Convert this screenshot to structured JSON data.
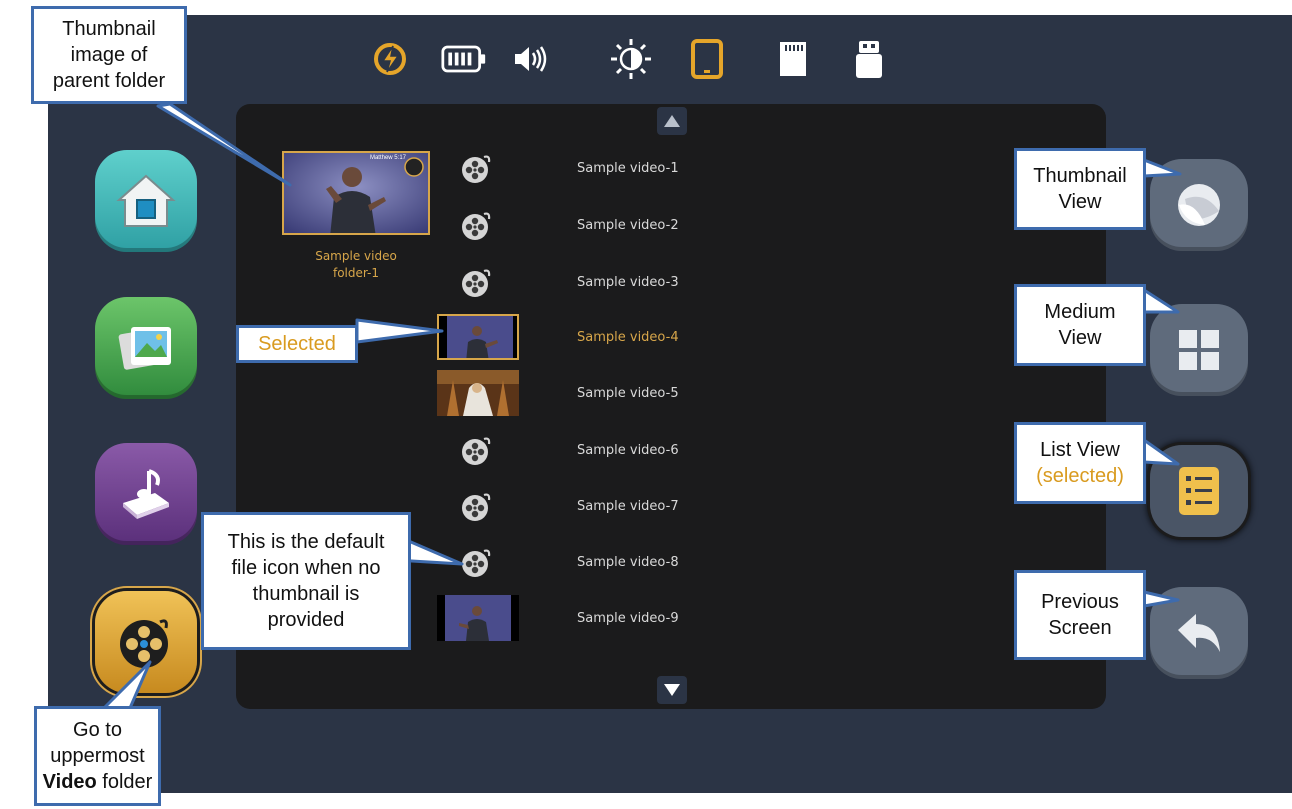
{
  "status_bar": {
    "icons": [
      "power-icon",
      "battery-icon",
      "volume-icon",
      "brightness-icon",
      "tablet-icon",
      "sd-card-icon",
      "usb-drive-icon"
    ]
  },
  "folder": {
    "name_line1": "Sample video",
    "name_line2": "folder-1",
    "thumb_caption": "Matthew 5:17"
  },
  "file_list": [
    {
      "label": "Sample video-1",
      "icon": "default-file-icon"
    },
    {
      "label": "Sample video-2",
      "icon": "default-file-icon"
    },
    {
      "label": "Sample video-3",
      "icon": "default-file-icon"
    },
    {
      "label": "Sample video-4",
      "icon": "thumbnail",
      "selected": true
    },
    {
      "label": "Sample video-5",
      "icon": "thumbnail"
    },
    {
      "label": "Sample video-6",
      "icon": "default-file-icon"
    },
    {
      "label": "Sample video-7",
      "icon": "default-file-icon"
    },
    {
      "label": "Sample video-8",
      "icon": "default-file-icon"
    },
    {
      "label": "Sample video-9",
      "icon": "thumbnail"
    }
  ],
  "left_nav": [
    "home-icon",
    "pictures-icon",
    "music-icon",
    "video-icon"
  ],
  "right_nav": [
    "thumbnail-view-icon",
    "medium-view-icon",
    "list-view-icon",
    "back-icon"
  ],
  "callouts": {
    "parent_folder": [
      "Thumbnail",
      "image of",
      "parent folder"
    ],
    "selected": "Selected",
    "default_icon": [
      "This is the default",
      "file icon when no",
      "thumbnail is",
      "provided"
    ],
    "video_folder": {
      "line1": "Go to",
      "line2": "uppermost",
      "bold": "Video",
      "rest": " folder"
    },
    "thumbnail_view": [
      "Thumbnail",
      "View"
    ],
    "medium_view": [
      "Medium",
      "View"
    ],
    "list_view": {
      "line1": "List View",
      "line2": "(selected)"
    },
    "previous_screen": [
      "Previous",
      "Screen"
    ]
  },
  "colors": {
    "accent": "#d7a64a",
    "screen_bg": "#2b3445",
    "panel_bg": "#1b1b1c",
    "callout_border": "#3e6bad"
  }
}
